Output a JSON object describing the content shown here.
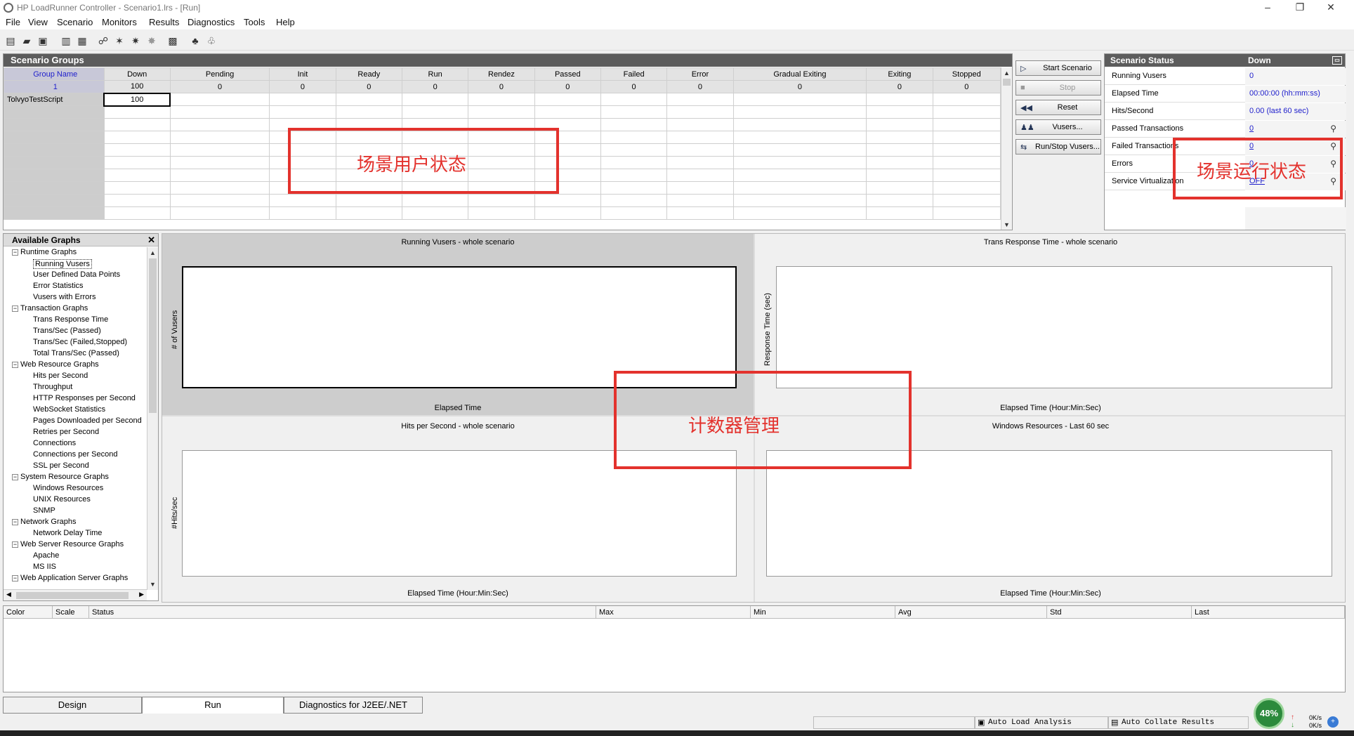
{
  "window": {
    "title": "HP LoadRunner Controller - Scenario1.lrs - [Run]",
    "controls": [
      "–",
      "❐",
      "✕"
    ]
  },
  "menu": [
    "File",
    "View",
    "Scenario",
    "Monitors",
    "Results",
    "Diagnostics",
    "Tools",
    "Help"
  ],
  "toolbar": {
    "icons": [
      "new-icon",
      "open-icon",
      "save-icon",
      "design-icon",
      "run-icon",
      "start-icon",
      "stop-icon",
      "gradual-icon",
      "stop-gradual-icon",
      "analysis-icon",
      "collate-icon",
      "results-icon"
    ]
  },
  "scenario_groups": {
    "title": "Scenario Groups",
    "columns": [
      "Group Name",
      "Down",
      "Pending",
      "Init",
      "Ready",
      "Run",
      "Rendez",
      "Passed",
      "Failed",
      "Error",
      "Gradual Exiting",
      "Exiting",
      "Stopped"
    ],
    "totals": [
      "1",
      "100",
      "0",
      "0",
      "0",
      "0",
      "0",
      "0",
      "0",
      "0",
      "0",
      "0",
      "0"
    ],
    "rows": [
      [
        "TolvyoTestScript",
        "100",
        "",
        "",
        "",
        "",
        "",
        "",
        "",
        "",
        "",
        "",
        ""
      ]
    ]
  },
  "actions": {
    "start": "Start Scenario",
    "stop": "Stop",
    "reset": "Reset",
    "vusers": "Vusers...",
    "run_stop_vusers": "Run/Stop Vusers..."
  },
  "scenario_status": {
    "title": "Scenario Status",
    "state": "Down",
    "rows": [
      {
        "label": "Running Vusers",
        "value": "0"
      },
      {
        "label": "Elapsed Time",
        "value": "00:00:00 (hh:mm:ss)"
      },
      {
        "label": "Hits/Second",
        "value": "0.00 (last 60 sec)"
      },
      {
        "label": "Passed Transactions",
        "value": "0"
      },
      {
        "label": "Failed Transactions",
        "value": "0"
      },
      {
        "label": "Errors",
        "value": "0"
      },
      {
        "label": "Service Virtualization",
        "value": "OFF"
      }
    ]
  },
  "available_graphs": {
    "title": "Available Graphs",
    "tree": [
      {
        "label": "Runtime Graphs",
        "cat": true
      },
      {
        "label": "Running Vusers",
        "selected": true
      },
      {
        "label": "User Defined Data Points"
      },
      {
        "label": "Error Statistics"
      },
      {
        "label": "Vusers with Errors"
      },
      {
        "label": "Transaction Graphs",
        "cat": true
      },
      {
        "label": "Trans Response Time"
      },
      {
        "label": "Trans/Sec (Passed)"
      },
      {
        "label": "Trans/Sec (Failed,Stopped)"
      },
      {
        "label": "Total Trans/Sec (Passed)"
      },
      {
        "label": "Web Resource Graphs",
        "cat": true
      },
      {
        "label": "Hits per Second"
      },
      {
        "label": "Throughput"
      },
      {
        "label": "HTTP Responses per Second"
      },
      {
        "label": "WebSocket Statistics"
      },
      {
        "label": "Pages Downloaded per Second"
      },
      {
        "label": "Retries per Second"
      },
      {
        "label": "Connections"
      },
      {
        "label": "Connections per Second"
      },
      {
        "label": "SSL per Second"
      },
      {
        "label": "System Resource Graphs",
        "cat": true
      },
      {
        "label": "Windows Resources"
      },
      {
        "label": "UNIX Resources"
      },
      {
        "label": "SNMP"
      },
      {
        "label": "Network Graphs",
        "cat": true
      },
      {
        "label": "Network Delay Time"
      },
      {
        "label": "Web Server Resource Graphs",
        "cat": true
      },
      {
        "label": "Apache"
      },
      {
        "label": "MS IIS"
      },
      {
        "label": "Web Application Server Graphs",
        "cat": true
      }
    ]
  },
  "graphs": [
    {
      "title": "Running Vusers - whole scenario",
      "ylabel": "# of Vusers",
      "xlabel": "Elapsed Time"
    },
    {
      "title": "Trans Response Time - whole scenario",
      "ylabel": "Response Time (sec)",
      "xlabel": "Elapsed Time (Hour:Min:Sec)"
    },
    {
      "title": "Hits per Second - whole scenario",
      "ylabel": "#Hits/sec",
      "xlabel": "Elapsed Time (Hour:Min:Sec)"
    },
    {
      "title": "Windows Resources - Last 60 sec",
      "ylabel": "",
      "xlabel": "Elapsed Time (Hour:Min:Sec)"
    }
  ],
  "legend": {
    "columns": [
      "Color",
      "Scale",
      "Status",
      "Max",
      "Min",
      "Avg",
      "Std",
      "Last"
    ]
  },
  "tabs": [
    "Design",
    "Run",
    "Diagnostics for J2EE/.NET"
  ],
  "statusbar": {
    "auto_load": "Auto Load Analysis",
    "auto_collate": "Auto Collate Results",
    "net_percent": "48%",
    "up": "0K/s",
    "down": "0K/s"
  },
  "annotations": {
    "users_state": "场景用户状态",
    "run_state": "场景运行状态",
    "counter_mgmt": "计数器管理"
  },
  "colors": {
    "annotation": "#e3322d",
    "header": "#5c5c5c",
    "link": "#2020cc"
  }
}
